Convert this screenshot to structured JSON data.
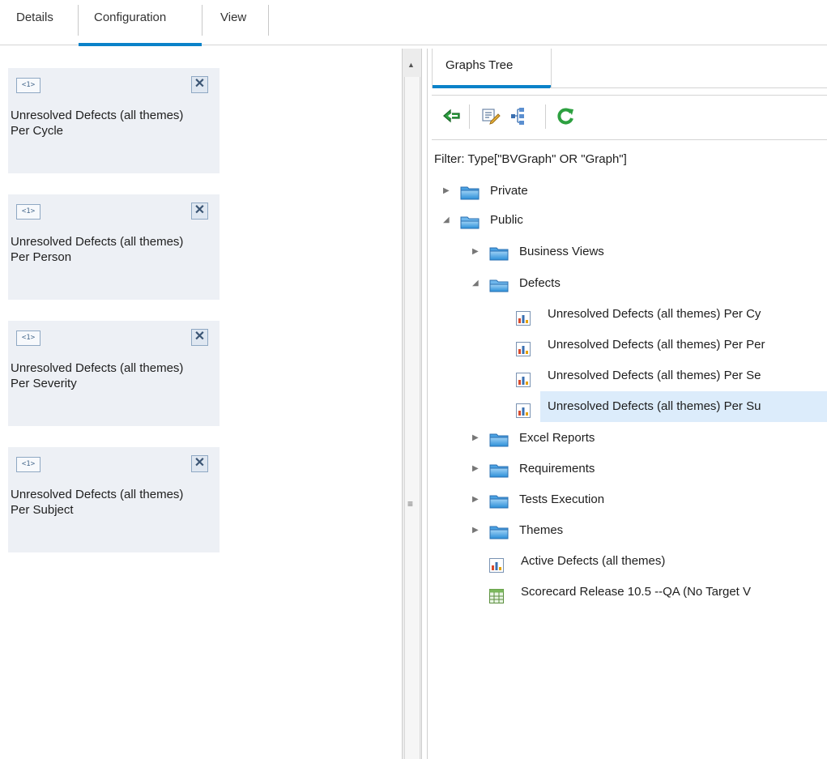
{
  "top_tabs": [
    "Details",
    "Configuration",
    "View"
  ],
  "active_top_tab": "Configuration",
  "cards": [
    {
      "tag": "<1>",
      "title": "Unresolved Defects (all themes) Per Cycle"
    },
    {
      "tag": "<1>",
      "title": "Unresolved Defects (all themes) Per Person"
    },
    {
      "tag": "<1>",
      "title": "Unresolved Defects (all themes) Per Severity"
    },
    {
      "tag": "<1>",
      "title": "Unresolved Defects (all themes) Per Subject"
    }
  ],
  "panel": {
    "tab_label": "Graphs Tree",
    "filter": "Filter: Type[\"BVGraph\" OR \"Graph\"]",
    "toolbar": [
      "back-icon",
      "edit-icon",
      "tree-layout-icon",
      "refresh-icon"
    ]
  },
  "tree": [
    {
      "label": "Private",
      "type": "folder",
      "expanded": false
    },
    {
      "label": "Public",
      "type": "folder",
      "expanded": true
    },
    {
      "label": "Business Views",
      "type": "folder",
      "expanded": false
    },
    {
      "label": "Defects",
      "type": "folder",
      "expanded": true
    },
    {
      "label": "Unresolved Defects (all themes) Per Cy",
      "type": "chart"
    },
    {
      "label": "Unresolved Defects (all themes) Per Per",
      "type": "chart"
    },
    {
      "label": "Unresolved Defects (all themes) Per Se",
      "type": "chart"
    },
    {
      "label": "Unresolved Defects (all themes) Per Su",
      "type": "chart",
      "selected": true
    },
    {
      "label": "Excel Reports",
      "type": "folder",
      "expanded": false
    },
    {
      "label": "Requirements",
      "type": "folder",
      "expanded": false
    },
    {
      "label": "Tests Execution",
      "type": "folder",
      "expanded": false
    },
    {
      "label": "Themes",
      "type": "folder",
      "expanded": false
    },
    {
      "label": "Active Defects (all themes)",
      "type": "chart"
    },
    {
      "label": "Scorecard Release 10.5 --QA (No Target V",
      "type": "scorecard"
    }
  ],
  "colors": {
    "accent": "#0a82c9",
    "selection": "#dcecfb",
    "card_bg": "#edf0f5"
  }
}
